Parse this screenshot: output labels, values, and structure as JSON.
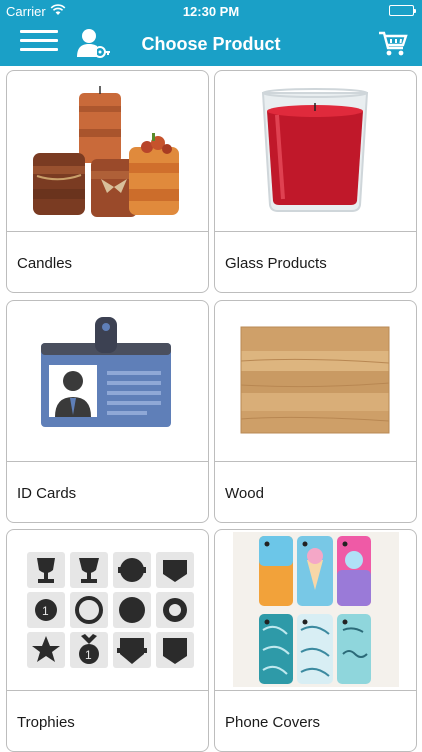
{
  "status_bar": {
    "carrier": "Carrier",
    "time": "12:30 PM",
    "battery_level": 1.0
  },
  "nav_bar": {
    "title": "Choose Product",
    "menu_icon": "hamburger-menu-icon",
    "profile_icon": "user-key-icon",
    "cart_icon": "shopping-cart-icon",
    "background_color": "#1aa0c7"
  },
  "products": [
    {
      "label": "Candles",
      "image": "candles-image"
    },
    {
      "label": "Glass Products",
      "image": "glass-candle-image"
    },
    {
      "label": "ID Cards",
      "image": "id-card-image"
    },
    {
      "label": "Wood",
      "image": "wood-board-image"
    },
    {
      "label": "Trophies",
      "image": "trophy-badges-image"
    },
    {
      "label": "Phone Covers",
      "image": "phone-covers-image"
    }
  ]
}
